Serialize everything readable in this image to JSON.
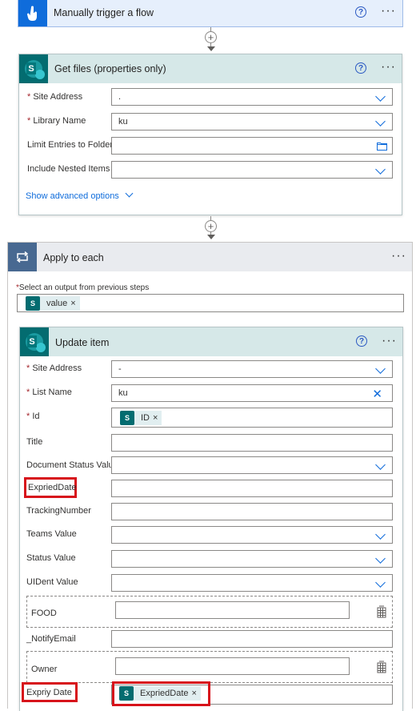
{
  "trigger": {
    "title": "Manually trigger a flow",
    "icon": "hand-touch-icon",
    "color": "#0f6cdb"
  },
  "get_files": {
    "title": "Get files (properties only)",
    "fields": {
      "site_address": {
        "label": "Site Address",
        "value": "."
      },
      "library_name": {
        "label": "Library Name",
        "value": "ku"
      },
      "limit_folder": {
        "label": "Limit Entries to Folder",
        "value": ""
      },
      "nested_items": {
        "label": "Include Nested Items",
        "value": ""
      }
    },
    "advanced": "Show advanced options"
  },
  "apply_each": {
    "title": "Apply to each",
    "select_label": "Select an output from previous steps",
    "token": "value"
  },
  "update_item": {
    "title": "Update item",
    "site_address": {
      "label": "Site Address",
      "value": "-"
    },
    "list_name": {
      "label": "List Name",
      "value": "ku"
    },
    "id": {
      "label": "Id",
      "token": "ID"
    },
    "title_f": {
      "label": "Title"
    },
    "doc_status": {
      "label": "Document Status Value"
    },
    "expried_date": {
      "label": "ExpriedDate"
    },
    "tracking": {
      "label": "TrackingNumber"
    },
    "teams": {
      "label": "Teams Value"
    },
    "status": {
      "label": "Status Value"
    },
    "uident": {
      "label": "UIDent Value"
    },
    "food": {
      "label": "FOOD"
    },
    "notify": {
      "label": "_NotifyEmail"
    },
    "owner": {
      "label": "Owner"
    },
    "expiry_date": {
      "label": "Expriy Date",
      "token": "ExpriedDate"
    }
  },
  "colors": {
    "highlight": "#d7131b",
    "sharepoint": "#036c70",
    "accent": "#0f6cdb"
  }
}
